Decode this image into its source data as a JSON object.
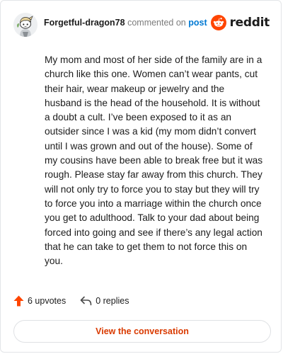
{
  "header": {
    "username": "Forgetful-dragon78",
    "commented_text": "commented on",
    "post_link": "post",
    "brand": "reddit"
  },
  "comment": {
    "body": "My mom and most of her side of the family are in a church like this one. Women can’t wear pants, cut their hair, wear makeup or jewelry and the husband is the head of the household. It is without a doubt a cult. I’ve been exposed to it as an outsider since I was a kid (my mom didn’t convert until I was grown and out of the house). Some of my cousins have been able to break free but it was rough. Please stay far away from this church. They will not only try to force you to stay but they will try to force you into a marriage within the church once you get to adulthood. Talk to your dad about being forced into going and see if there’s any legal action that he can take to get them to not force this on you."
  },
  "actions": {
    "upvotes": "6 upvotes",
    "replies": "0 replies"
  },
  "cta": {
    "label": "View the conversation"
  },
  "colors": {
    "accent": "#d93a00",
    "link": "#0079d3",
    "reddit_orange": "#ff4500",
    "upvote": "#ff4500"
  },
  "icons": {
    "avatar": "snoo-avatar",
    "brand": "reddit-logo-icon",
    "upvote": "upvote-arrow-icon",
    "reply": "reply-arrow-icon"
  }
}
